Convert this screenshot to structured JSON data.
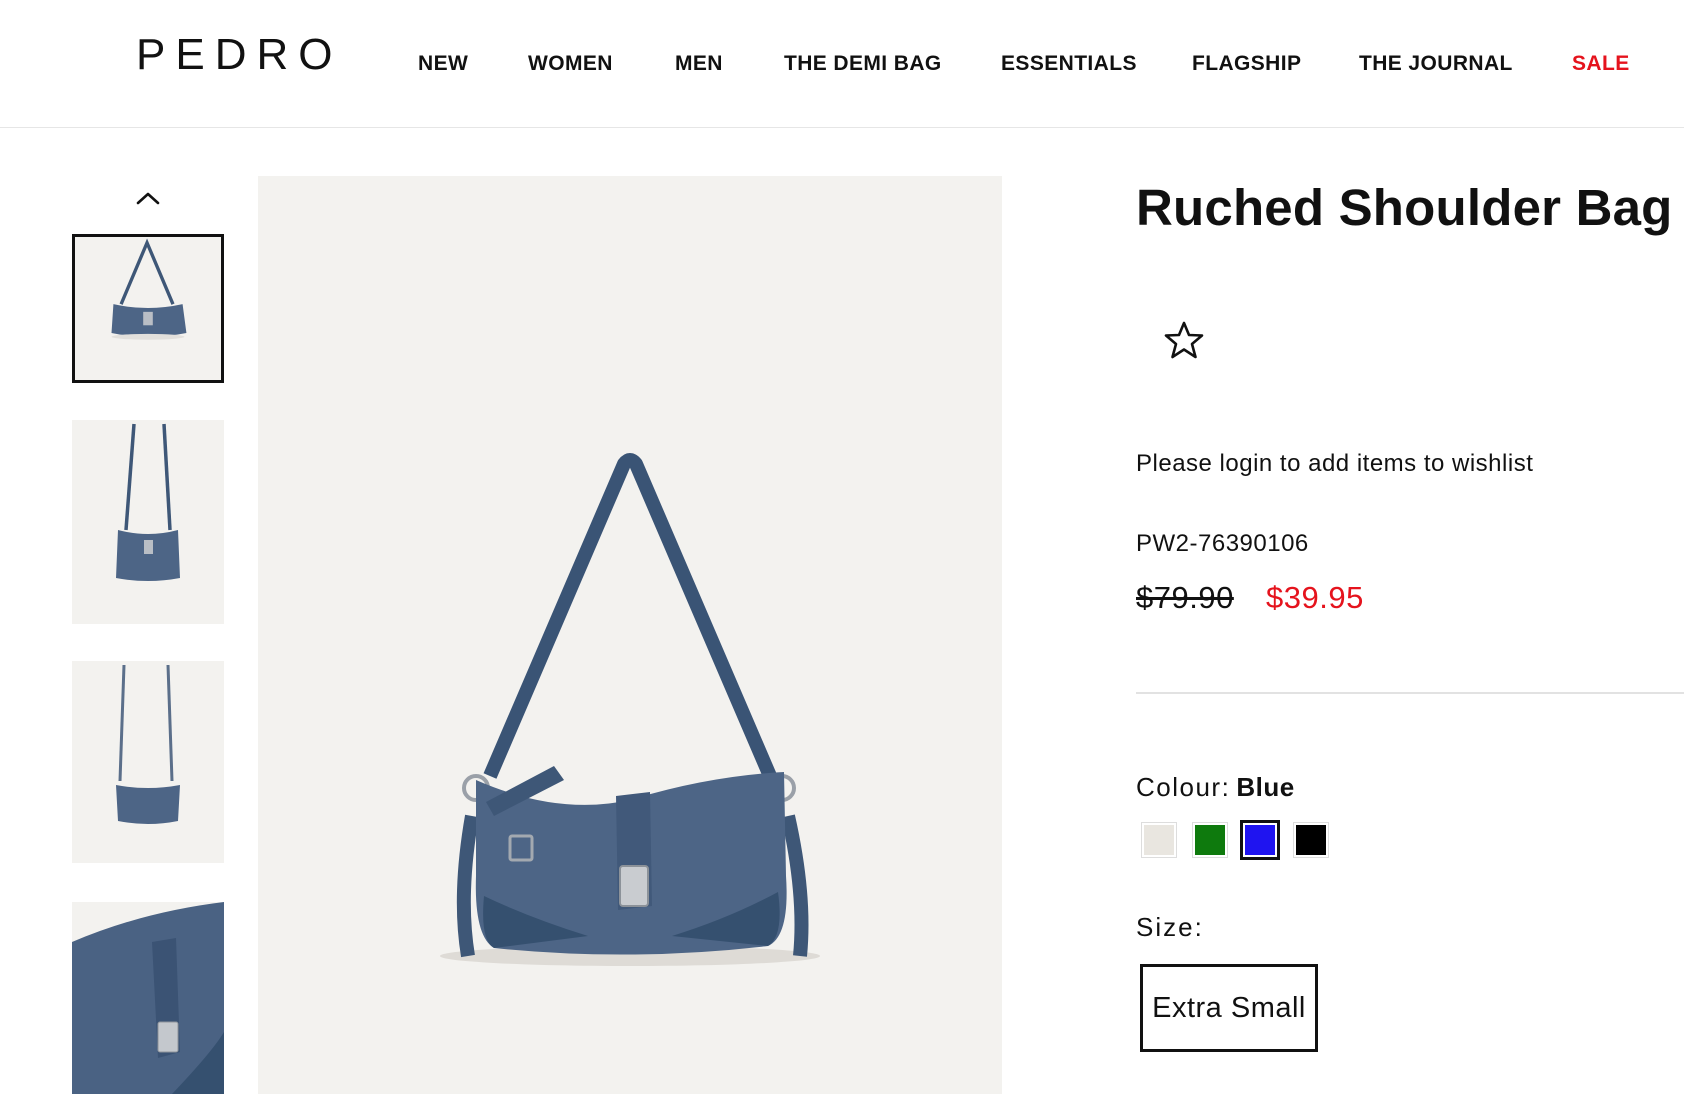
{
  "brand": {
    "logo": "PEDRO"
  },
  "nav": {
    "items": [
      {
        "label": "NEW"
      },
      {
        "label": "WOMEN"
      },
      {
        "label": "MEN"
      },
      {
        "label": "THE DEMI BAG"
      },
      {
        "label": "ESSENTIALS"
      },
      {
        "label": "FLAGSHIP"
      },
      {
        "label": "THE JOURNAL"
      },
      {
        "label": "SALE"
      }
    ]
  },
  "gallery": {
    "up_icon": "chevron-up-icon",
    "thumbnails": [
      {
        "view": "front",
        "active": true
      },
      {
        "view": "crossbody-front",
        "active": false
      },
      {
        "view": "crossbody-angle",
        "active": false
      },
      {
        "view": "detail-closeup",
        "active": false
      }
    ]
  },
  "product": {
    "title": "Ruched Shoulder Bag",
    "wishlist_icon": "star-outline-icon",
    "login_message": "Please login to add items to wishlist",
    "sku": "PW2-76390106",
    "price_original": "$79.90",
    "price_sale": "$39.95",
    "colour_label": "Colour:",
    "colour_selected": "Blue",
    "colours": [
      {
        "name": "Chalk",
        "hex": "#e9e6e0"
      },
      {
        "name": "Green",
        "hex": "#0e7a0d"
      },
      {
        "name": "Blue",
        "hex": "#1f14f0",
        "selected": true
      },
      {
        "name": "Black",
        "hex": "#000000"
      }
    ],
    "size_label": "Size:",
    "size_option": "Extra Small"
  },
  "colors": {
    "sale_red": "#e5131d",
    "bag_denim": "#3e5777"
  }
}
